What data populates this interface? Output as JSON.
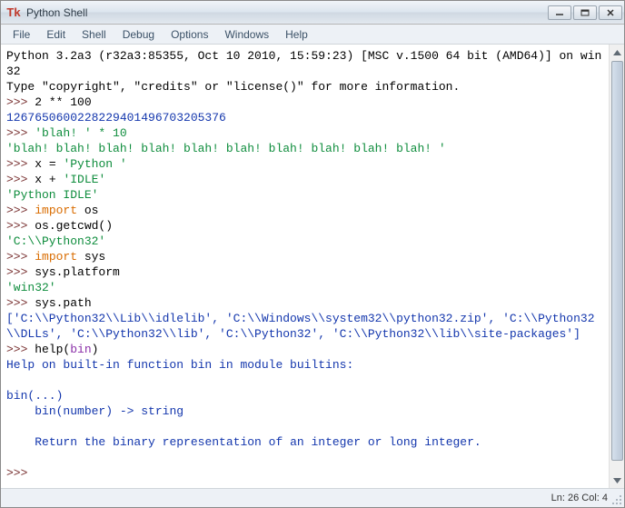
{
  "window": {
    "title": "Python Shell",
    "app_icon_label": "Tk"
  },
  "menu": {
    "file": "File",
    "edit": "Edit",
    "shell": "Shell",
    "debug": "Debug",
    "options": "Options",
    "windows": "Windows",
    "help": "Help"
  },
  "console": {
    "banner_line1": "Python 3.2a3 (r32a3:85355, Oct 10 2010, 15:59:23) [MSC v.1500 64 bit (AMD64)] on win32",
    "banner_line2": "Type \"copyright\", \"credits\" or \"license()\" for more information.",
    "prompt": ">>> ",
    "cont_indent": "    ",
    "cmd1": "2 ** 100",
    "out1": "1267650600228229401496703205376",
    "cmd2": "'blah! ' * 10",
    "out2": "'blah! blah! blah! blah! blah! blah! blah! blah! blah! blah! '",
    "cmd3_pre": "x = ",
    "cmd3_str": "'Python '",
    "cmd4_pre": "x + ",
    "cmd4_str": "'IDLE'",
    "out4": "'Python IDLE'",
    "cmd5_kw": "import",
    "cmd5_rest": " os",
    "cmd6": "os.getcwd()",
    "out6": "'C:\\\\Python32'",
    "cmd7_kw": "import",
    "cmd7_rest": " sys",
    "cmd8": "sys.platform",
    "out8": "'win32'",
    "cmd9": "sys.path",
    "out9": "['C:\\\\Python32\\\\Lib\\\\idlelib', 'C:\\\\Windows\\\\system32\\\\python32.zip', 'C:\\\\Python32\\\\DLLs', 'C:\\\\Python32\\\\lib', 'C:\\\\Python32', 'C:\\\\Python32\\\\lib\\\\site-packages']",
    "cmd10_pre": "help(",
    "cmd10_builtin": "bin",
    "cmd10_post": ")",
    "help_l1": "Help on built-in function bin in module builtins:",
    "help_blank": "",
    "help_l2": "bin(...)",
    "help_l3": "    bin(number) -> string",
    "help_l4": "    Return the binary representation of an integer or long integer."
  },
  "status": {
    "text": "Ln: 26 Col: 4"
  }
}
